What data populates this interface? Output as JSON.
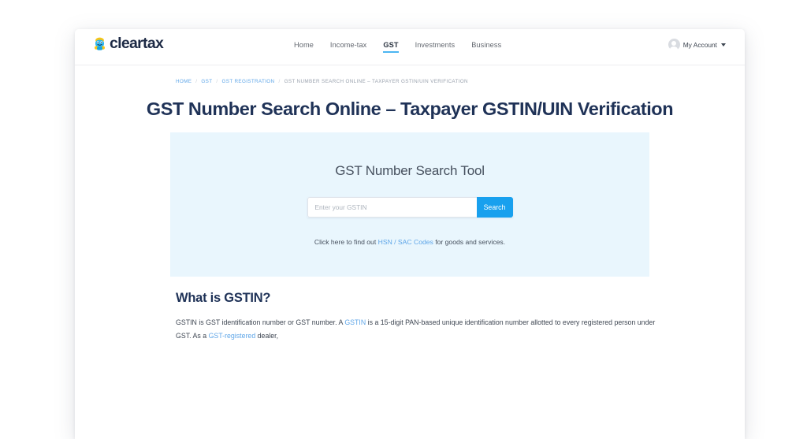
{
  "header": {
    "logo": {
      "icon": "cleartax-mascot-icon",
      "word": "cleartax",
      "colors": {
        "hair": "#f5c518",
        "body": "#2ab6ef",
        "accent": "#15a5e0",
        "word": "#1d2a45"
      }
    },
    "nav": [
      {
        "label": "Home",
        "active": false
      },
      {
        "label": "Income-tax",
        "active": false
      },
      {
        "label": "GST",
        "active": true
      },
      {
        "label": "Investments",
        "active": false
      },
      {
        "label": "Business",
        "active": false
      }
    ],
    "account": {
      "label": "My Account",
      "avatar_icon": "user-avatar-icon",
      "caret_icon": "chevron-down-icon"
    }
  },
  "breadcrumb": {
    "items": [
      {
        "label": "HOME",
        "is_link": true
      },
      {
        "label": "GST",
        "is_link": true
      },
      {
        "label": "GST REGISTRATION",
        "is_link": true
      },
      {
        "label": "GST NUMBER SEARCH ONLINE – TAXPAYER GSTIN/UIN VERIFICATION",
        "is_link": false
      }
    ],
    "separator": "/"
  },
  "page": {
    "title": "GST Number Search Online – Taxpayer GSTIN/UIN Verification"
  },
  "search_panel": {
    "title": "GST Number Search Tool",
    "input_placeholder": "Enter your GSTIN",
    "input_value": "",
    "button_label": "Search",
    "note_prefix": "Click here to find out ",
    "note_link": "HSN / SAC Codes",
    "note_suffix": " for goods and services.",
    "background_color": "#e9f6fd",
    "button_color": "#18a0ee"
  },
  "article": {
    "heading": "What is GSTIN?",
    "paragraph": {
      "part1": "GSTIN is GST identification number or GST number. A ",
      "link1": "GSTIN",
      "part2": " is a 15-digit PAN-based unique identification number allotted to every registered person under GST. As a ",
      "link2": "GST-registered",
      "part3": " dealer,"
    }
  },
  "theme": {
    "heading_color": "#1f3257",
    "link_color": "#5fa6e8",
    "body_text_color": "#3f4753",
    "nav_active_underline": "#4cb6f2"
  }
}
